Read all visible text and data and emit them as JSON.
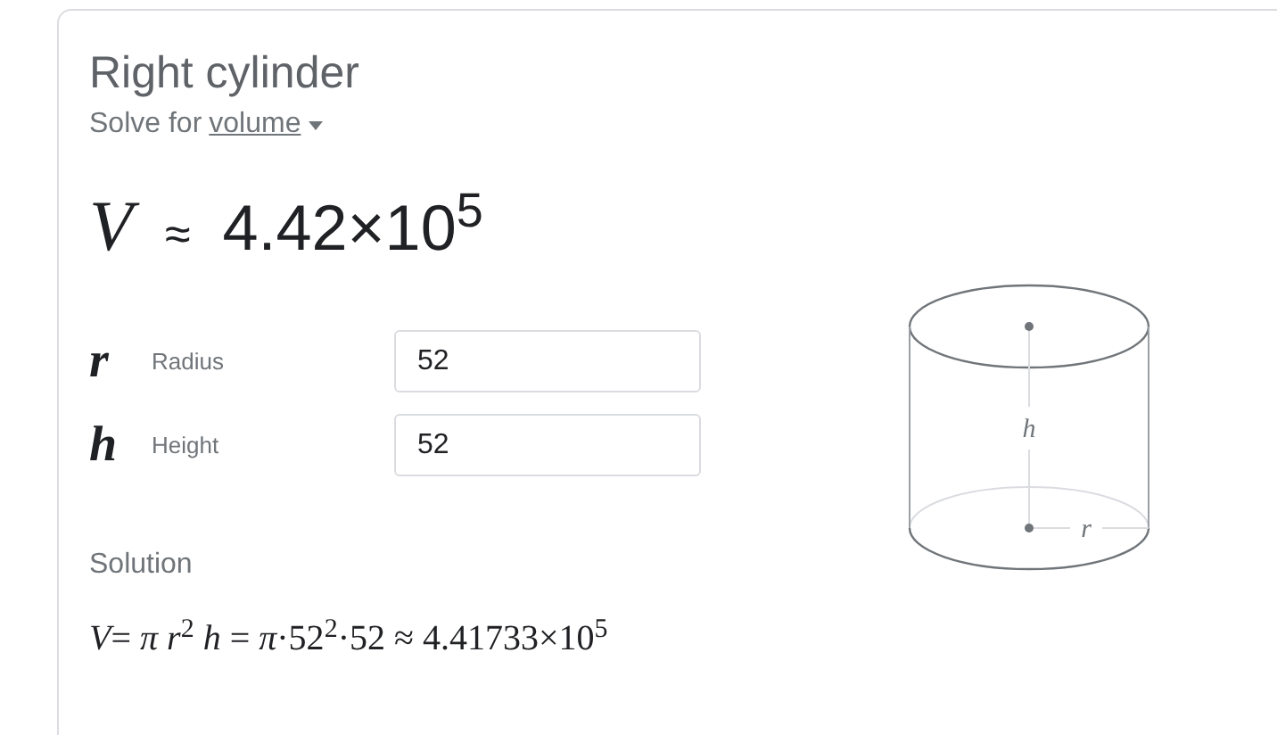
{
  "title": "Right cylinder",
  "solve_for": {
    "prefix": "Solve for",
    "value": "volume"
  },
  "result": {
    "variable": "V",
    "approx": "≈",
    "value": "4.42×10$^{5}$"
  },
  "inputs": [
    {
      "symbol": "r",
      "label": "Radius",
      "value": "52"
    },
    {
      "symbol": "h",
      "label": "Height",
      "value": "52"
    }
  ],
  "solution": {
    "heading": "Solution",
    "formula": "*V*= *π* *r*$^{2}$ *h* = *π*·52$^{2}$·52 ≈ 4.41733×10$^{5}$"
  },
  "diagram": {
    "height_label": "h",
    "radius_label": "r"
  }
}
